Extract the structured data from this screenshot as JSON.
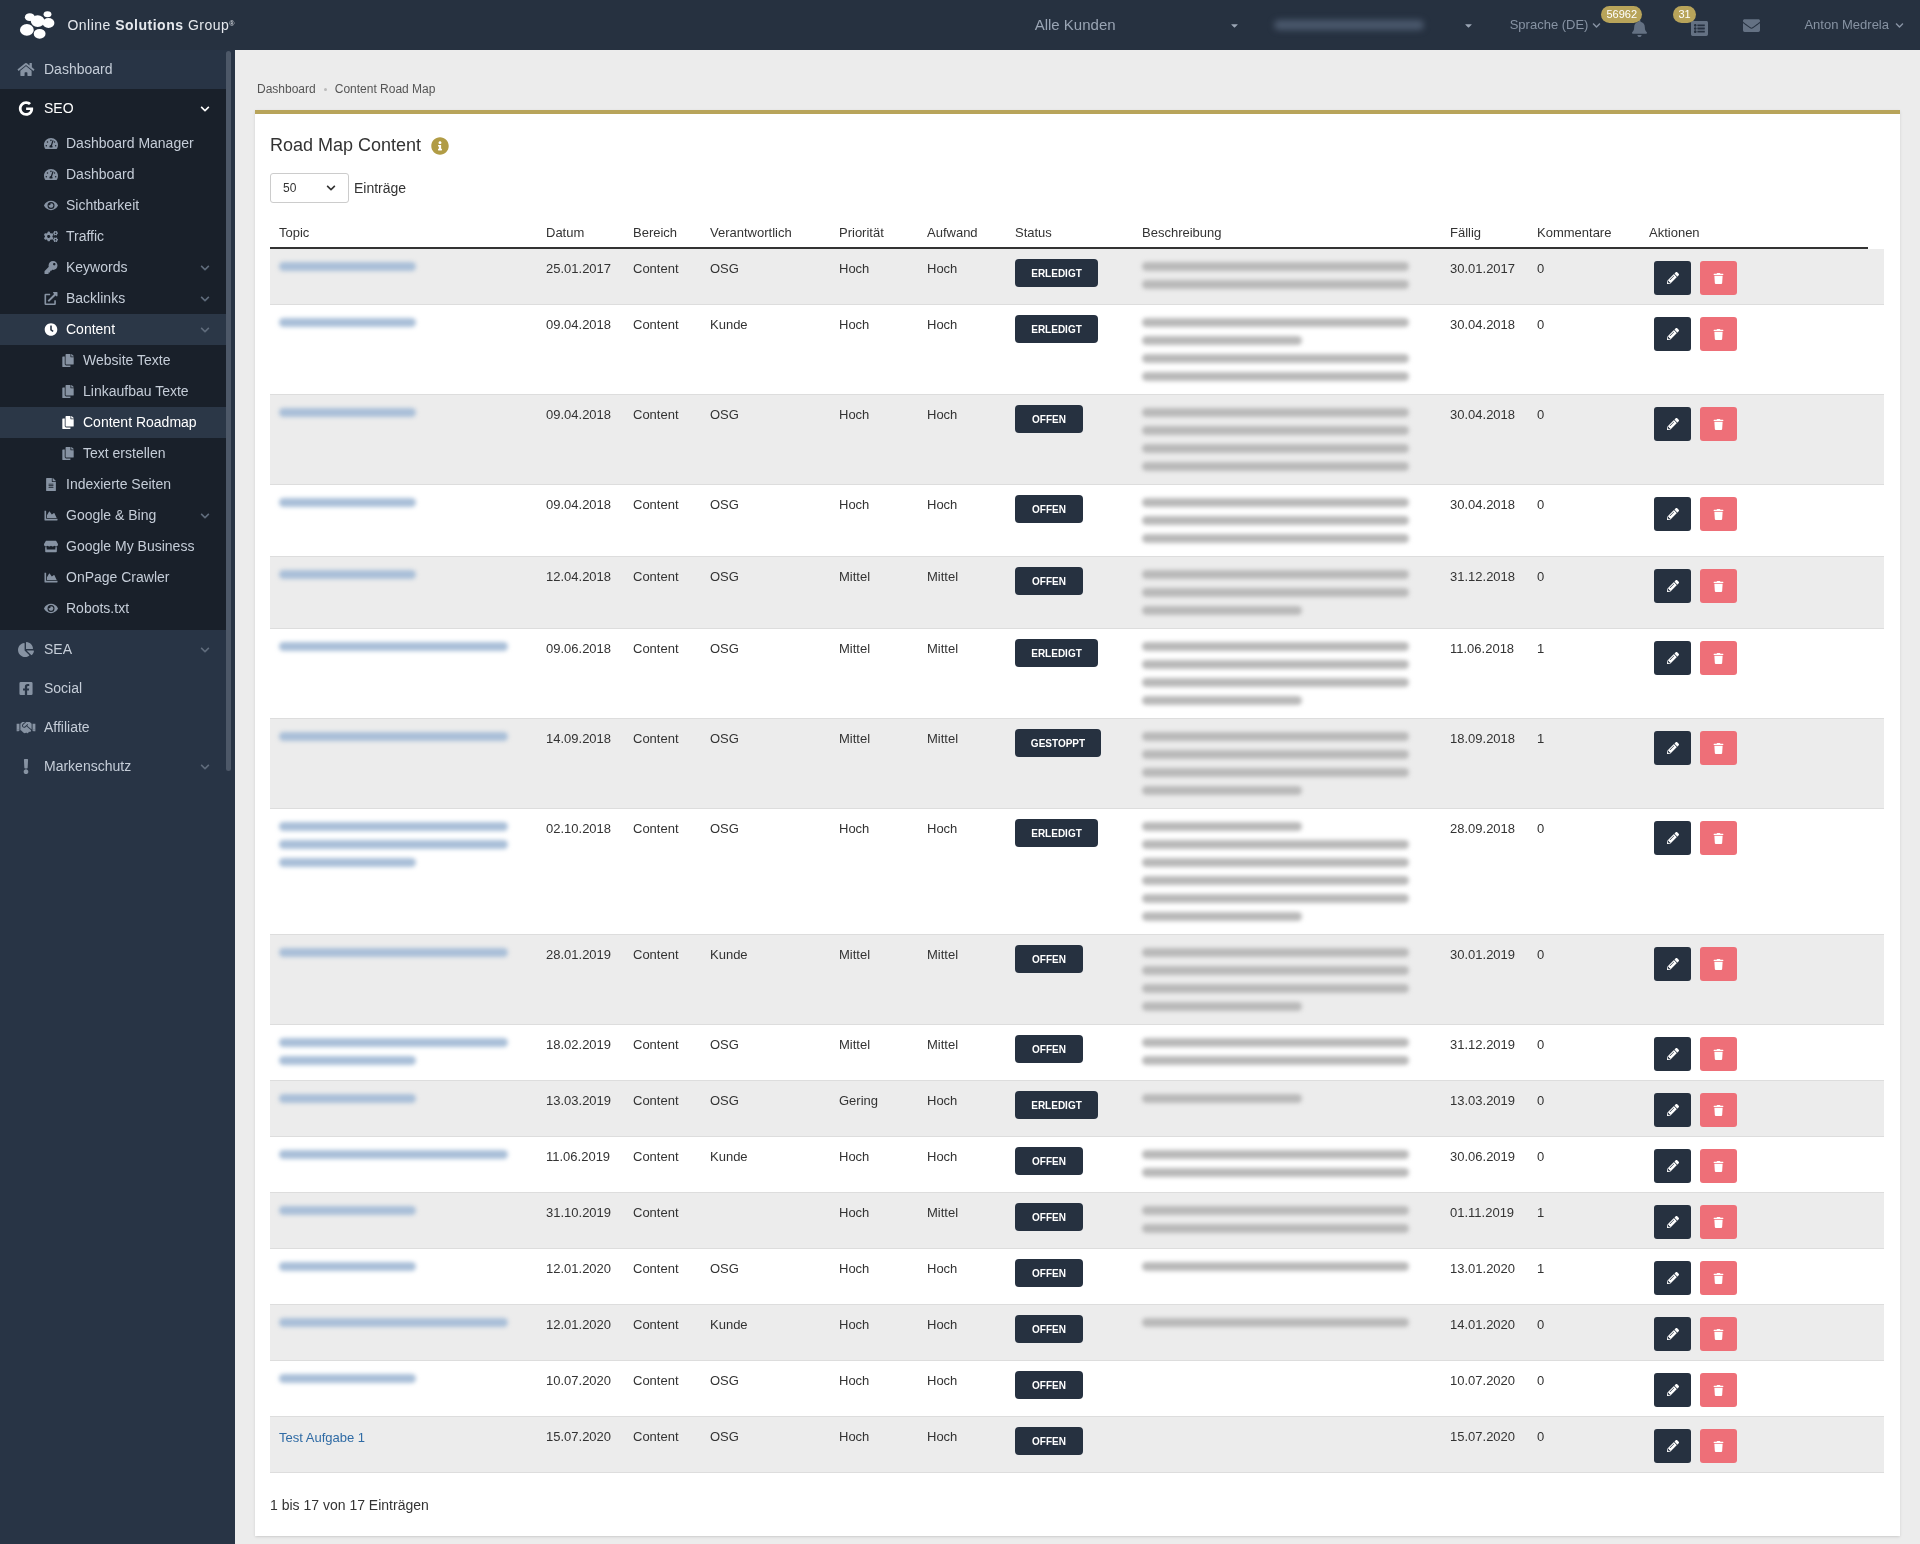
{
  "header": {
    "brand": "Online **Solutions** Group",
    "brand_mark": "®",
    "customer_select": "Alle Kunden",
    "account_select_redacted": true,
    "language": "Sprache (DE)",
    "notifications_badge": "56962",
    "tasks_badge": "31",
    "user": "Anton Medrela"
  },
  "sidebar": {
    "items": [
      {
        "label": "Dashboard",
        "kind": "home",
        "selected": false,
        "expanded": false,
        "has_children": false
      },
      {
        "label": "SEO",
        "kind": "google",
        "selected": false,
        "expanded": true,
        "has_children": true,
        "children": [
          {
            "label": "Dashboard Manager",
            "kind": "gauge",
            "selected": false,
            "expanded": false,
            "has_children": false
          },
          {
            "label": "Dashboard",
            "kind": "gauge",
            "selected": false,
            "expanded": false,
            "has_children": false
          },
          {
            "label": "Sichtbarkeit",
            "kind": "eye",
            "selected": false,
            "expanded": false,
            "has_children": false
          },
          {
            "label": "Traffic",
            "kind": "cogs",
            "selected": false,
            "expanded": false,
            "has_children": false
          },
          {
            "label": "Keywords",
            "kind": "key",
            "selected": false,
            "expanded": false,
            "has_children": true
          },
          {
            "label": "Backlinks",
            "kind": "external",
            "selected": false,
            "expanded": false,
            "has_children": true
          },
          {
            "label": "Content",
            "kind": "clock",
            "selected": true,
            "expanded": true,
            "has_children": true,
            "children": [
              {
                "label": "Website Texte",
                "kind": "copy",
                "selected": false,
                "expanded": false,
                "has_children": false
              },
              {
                "label": "Linkaufbau Texte",
                "kind": "copy",
                "selected": false,
                "expanded": false,
                "has_children": false
              },
              {
                "label": "Content Roadmap",
                "kind": "copy",
                "selected": true,
                "expanded": false,
                "has_children": false
              },
              {
                "label": "Text erstellen",
                "kind": "copy",
                "selected": false,
                "expanded": false,
                "has_children": false
              }
            ]
          },
          {
            "label": "Indexierte Seiten",
            "kind": "file",
            "selected": false,
            "expanded": false,
            "has_children": false
          },
          {
            "label": "Google & Bing",
            "kind": "area",
            "selected": false,
            "expanded": false,
            "has_children": true
          },
          {
            "label": "Google My Business",
            "kind": "store",
            "selected": false,
            "expanded": false,
            "has_children": false
          },
          {
            "label": "OnPage Crawler",
            "kind": "area",
            "selected": false,
            "expanded": false,
            "has_children": false
          },
          {
            "label": "Robots.txt",
            "kind": "eye",
            "selected": false,
            "expanded": false,
            "has_children": false
          }
        ]
      },
      {
        "label": "SEA",
        "kind": "pie",
        "selected": false,
        "expanded": false,
        "has_children": true
      },
      {
        "label": "Social",
        "kind": "facebook",
        "selected": false,
        "expanded": false,
        "has_children": false
      },
      {
        "label": "Affiliate",
        "kind": "handshake",
        "selected": false,
        "expanded": false,
        "has_children": false
      },
      {
        "label": "Markenschutz",
        "kind": "exclamation",
        "selected": false,
        "expanded": false,
        "has_children": true
      }
    ]
  },
  "breadcrumb": [
    "Dashboard",
    "Content Road Map"
  ],
  "card": {
    "title": "Road Map Content",
    "page_size": "50",
    "page_size_label": "Einträge",
    "table": {
      "columns": [
        "Topic",
        "Datum",
        "Bereich",
        "Verantwortlich",
        "Priorität",
        "Aufwand",
        "Status",
        "Beschreibung",
        "Fällig",
        "Kommentare",
        "Aktionen"
      ],
      "rows": [
        {
          "topic_blur": [
            {
              "kind": "short"
            }
          ],
          "datum": "25.01.2017",
          "bereich": "Content",
          "verantwortlich": "OSG",
          "prioritaet": "Hoch",
          "aufwand": "Hoch",
          "status": "ERLEDIGT",
          "description_blur": [
            {
              "kind": "full"
            },
            {
              "kind": "full"
            }
          ],
          "faellig": "30.01.2017",
          "kommentare": "0"
        },
        {
          "topic_blur": [
            {
              "kind": "short"
            }
          ],
          "datum": "09.04.2018",
          "bereich": "Content",
          "verantwortlich": "Kunde",
          "prioritaet": "Hoch",
          "aufwand": "Hoch",
          "status": "ERLEDIGT",
          "description_blur": [
            {
              "kind": "full"
            },
            {
              "kind": "short"
            },
            {
              "kind": "full"
            },
            {
              "kind": "full"
            }
          ],
          "faellig": "30.04.2018",
          "kommentare": "0"
        },
        {
          "topic_blur": [
            {
              "kind": "short"
            }
          ],
          "datum": "09.04.2018",
          "bereich": "Content",
          "verantwortlich": "OSG",
          "prioritaet": "Hoch",
          "aufwand": "Hoch",
          "status": "OFFEN",
          "description_blur": [
            {
              "kind": "full"
            },
            {
              "kind": "full"
            },
            {
              "kind": "full"
            },
            {
              "kind": "full"
            }
          ],
          "faellig": "30.04.2018",
          "kommentare": "0"
        },
        {
          "topic_blur": [
            {
              "kind": "short"
            }
          ],
          "datum": "09.04.2018",
          "bereich": "Content",
          "verantwortlich": "OSG",
          "prioritaet": "Hoch",
          "aufwand": "Hoch",
          "status": "OFFEN",
          "description_blur": [
            {
              "kind": "full"
            },
            {
              "kind": "full"
            },
            {
              "kind": "full"
            }
          ],
          "faellig": "30.04.2018",
          "kommentare": "0"
        },
        {
          "topic_blur": [
            {
              "kind": "short"
            }
          ],
          "datum": "12.04.2018",
          "bereich": "Content",
          "verantwortlich": "OSG",
          "prioritaet": "Mittel",
          "aufwand": "Mittel",
          "status": "OFFEN",
          "description_blur": [
            {
              "kind": "full"
            },
            {
              "kind": "full"
            },
            {
              "kind": "short"
            }
          ],
          "faellig": "31.12.2018",
          "kommentare": "0"
        },
        {
          "topic_blur": [
            {
              "kind": "full"
            }
          ],
          "datum": "09.06.2018",
          "bereich": "Content",
          "verantwortlich": "OSG",
          "prioritaet": "Mittel",
          "aufwand": "Mittel",
          "status": "ERLEDIGT",
          "description_blur": [
            {
              "kind": "full"
            },
            {
              "kind": "full"
            },
            {
              "kind": "full"
            },
            {
              "kind": "short"
            }
          ],
          "faellig": "11.06.2018",
          "kommentare": "1"
        },
        {
          "topic_blur": [
            {
              "kind": "full"
            }
          ],
          "datum": "14.09.2018",
          "bereich": "Content",
          "verantwortlich": "OSG",
          "prioritaet": "Mittel",
          "aufwand": "Mittel",
          "status": "GESTOPPT",
          "description_blur": [
            {
              "kind": "full"
            },
            {
              "kind": "full"
            },
            {
              "kind": "full"
            },
            {
              "kind": "short"
            }
          ],
          "faellig": "18.09.2018",
          "kommentare": "1"
        },
        {
          "topic_blur": [
            {
              "kind": "full"
            },
            {
              "kind": "full"
            },
            {
              "kind": "short"
            }
          ],
          "datum": "02.10.2018",
          "bereich": "Content",
          "verantwortlich": "OSG",
          "prioritaet": "Hoch",
          "aufwand": "Hoch",
          "status": "ERLEDIGT",
          "description_blur": [
            {
              "kind": "short"
            },
            {
              "kind": "full"
            },
            {
              "kind": "full"
            },
            {
              "kind": "full"
            },
            {
              "kind": "full"
            },
            {
              "kind": "short"
            }
          ],
          "faellig": "28.09.2018",
          "kommentare": "0"
        },
        {
          "topic_blur": [
            {
              "kind": "full"
            }
          ],
          "datum": "28.01.2019",
          "bereich": "Content",
          "verantwortlich": "Kunde",
          "prioritaet": "Mittel",
          "aufwand": "Mittel",
          "status": "OFFEN",
          "description_blur": [
            {
              "kind": "full"
            },
            {
              "kind": "full"
            },
            {
              "kind": "full"
            },
            {
              "kind": "short"
            }
          ],
          "faellig": "30.01.2019",
          "kommentare": "0"
        },
        {
          "topic_blur": [
            {
              "kind": "full"
            },
            {
              "kind": "short"
            }
          ],
          "datum": "18.02.2019",
          "bereich": "Content",
          "verantwortlich": "OSG",
          "prioritaet": "Mittel",
          "aufwand": "Mittel",
          "status": "OFFEN",
          "description_blur": [
            {
              "kind": "full"
            },
            {
              "kind": "full"
            }
          ],
          "faellig": "31.12.2019",
          "kommentare": "0"
        },
        {
          "topic_blur": [
            {
              "kind": "short"
            }
          ],
          "datum": "13.03.2019",
          "bereich": "Content",
          "verantwortlich": "OSG",
          "prioritaet": "Gering",
          "aufwand": "Hoch",
          "status": "ERLEDIGT",
          "description_blur": [
            {
              "kind": "short"
            }
          ],
          "faellig": "13.03.2019",
          "kommentare": "0"
        },
        {
          "topic_blur": [
            {
              "kind": "full"
            }
          ],
          "datum": "11.06.2019",
          "bereich": "Content",
          "verantwortlich": "Kunde",
          "prioritaet": "Hoch",
          "aufwand": "Hoch",
          "status": "OFFEN",
          "description_blur": [
            {
              "kind": "full"
            },
            {
              "kind": "full"
            }
          ],
          "faellig": "30.06.2019",
          "kommentare": "0"
        },
        {
          "topic_blur": [
            {
              "kind": "short"
            }
          ],
          "datum": "31.10.2019",
          "bereich": "Content",
          "prioritaet": "Hoch",
          "aufwand": "Mittel",
          "status": "OFFEN",
          "description_blur": [
            {
              "kind": "full"
            },
            {
              "kind": "full"
            }
          ],
          "faellig": "01.11.2019",
          "kommentare": "1"
        },
        {
          "topic_blur": [
            {
              "kind": "short"
            }
          ],
          "datum": "12.01.2020",
          "bereich": "Content",
          "verantwortlich": "OSG",
          "prioritaet": "Hoch",
          "aufwand": "Hoch",
          "status": "OFFEN",
          "description_blur": [
            {
              "kind": "full"
            }
          ],
          "faellig": "13.01.2020",
          "kommentare": "1"
        },
        {
          "topic_blur": [
            {
              "kind": "full"
            }
          ],
          "datum": "12.01.2020",
          "bereich": "Content",
          "verantwortlich": "Kunde",
          "prioritaet": "Hoch",
          "aufwand": "Hoch",
          "status": "OFFEN",
          "description_blur": [
            {
              "kind": "full"
            }
          ],
          "faellig": "14.01.2020",
          "kommentare": "0"
        },
        {
          "topic_blur": [
            {
              "kind": "short"
            }
          ],
          "datum": "10.07.2020",
          "bereich": "Content",
          "verantwortlich": "OSG",
          "prioritaet": "Hoch",
          "aufwand": "Hoch",
          "status": "OFFEN",
          "faellig": "10.07.2020",
          "kommentare": "0"
        },
        {
          "topic": "Test Aufgabe 1",
          "datum": "15.07.2020",
          "bereich": "Content",
          "verantwortlich": "OSG",
          "prioritaet": "Hoch",
          "aufwand": "Hoch",
          "status": "OFFEN",
          "faellig": "15.07.2020",
          "kommentare": "0"
        }
      ]
    },
    "footer": "1 bis 17 von 17 Einträgen"
  }
}
